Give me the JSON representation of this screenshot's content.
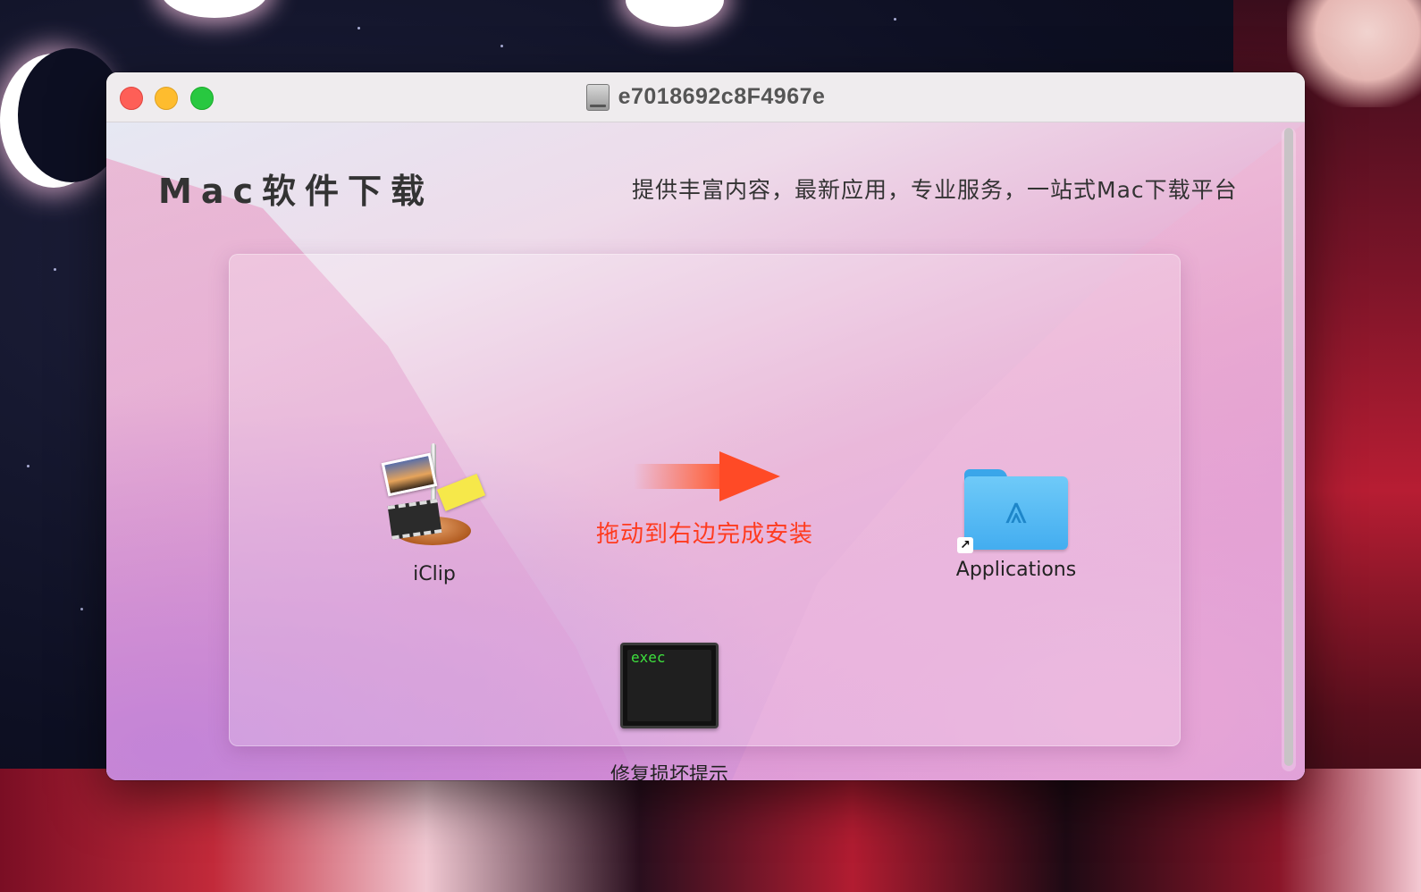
{
  "window": {
    "title": "e7018692c8F4967e",
    "traffic_lights": [
      "close",
      "minimize",
      "zoom"
    ]
  },
  "header": {
    "brand": "Mac软件下载",
    "tagline": "提供丰富内容，最新应用，专业服务，一站式Mac下载平台"
  },
  "installer": {
    "app_name": "iClip",
    "instruction": "拖动到右边完成安装",
    "target_folder": "Applications",
    "repair_tool_label": "修复损坏提示",
    "repair_tool_icon_text": "exec"
  },
  "colors": {
    "instruction": "#ff3b1f",
    "arrow": "#ff4a26",
    "folder": "#43adf0"
  },
  "icons": {
    "app": "iclip-app-icon",
    "arrow": "right-arrow-icon",
    "folder": "applications-folder-icon",
    "alias": "alias-arrow-icon",
    "exec": "exec-terminal-icon",
    "disk": "disk-image-icon"
  }
}
